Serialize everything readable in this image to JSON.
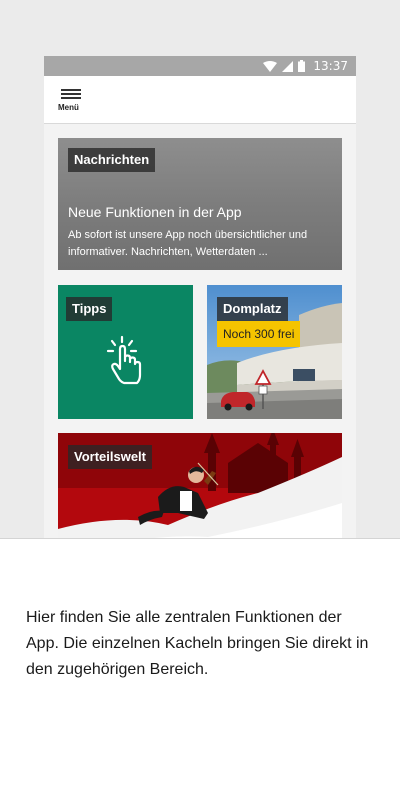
{
  "statusbar": {
    "time": "13:37",
    "icons": [
      "wifi-icon",
      "signal-icon",
      "battery-icon"
    ]
  },
  "appbar": {
    "menu_label": "Menü"
  },
  "tiles": {
    "news": {
      "tag": "Nachrichten",
      "title": "Neue Funktionen in der App",
      "text": "Ab sofort ist unsere App noch übersichtlicher und informativer. Nachrichten, Wetterdaten ..."
    },
    "tipps": {
      "tag": "Tipps",
      "icon": "tap-hand-icon"
    },
    "domplatz": {
      "tag": "Domplatz",
      "badge": "Noch 300 frei"
    },
    "vorteilswelt": {
      "tag": "Vorteilswelt"
    }
  },
  "explanation": "Hier finden Sie alle zentralen Funktionen der App. Die einzelnen Kacheln bringen Sie direkt in den zugehörigen Bereich.",
  "colors": {
    "statusbar": "#a7a7a7",
    "tipps_green": "#0a8663",
    "vorteil_red": "#b3080d",
    "badge_yellow": "#f5c400"
  }
}
